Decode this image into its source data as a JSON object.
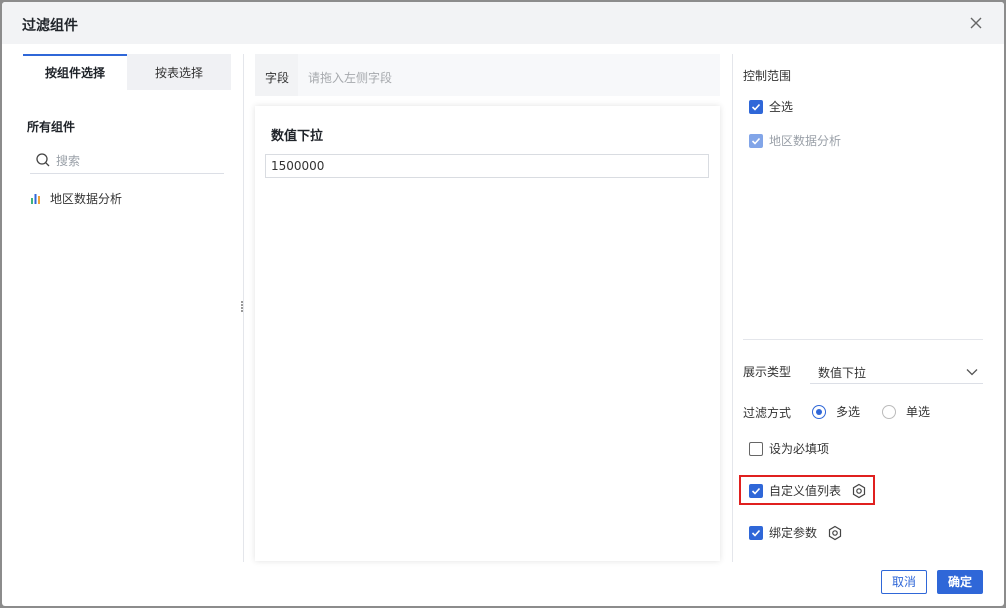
{
  "dialog": {
    "title": "过滤组件",
    "close_icon": "close-icon"
  },
  "left": {
    "tabs": [
      {
        "label": "按组件选择",
        "active": true
      },
      {
        "label": "按表选择",
        "active": false
      }
    ],
    "section_label": "所有组件",
    "search_placeholder": "搜索",
    "components": [
      {
        "label": "地区数据分析",
        "icon": "bar-chart-icon"
      }
    ]
  },
  "center": {
    "field_label": "字段",
    "field_placeholder": "请拖入左侧字段",
    "preview_title": "数值下拉",
    "preview_value": "1500000"
  },
  "right": {
    "scope_label": "控制范围",
    "select_all": "全选",
    "scope_items": [
      "地区数据分析"
    ],
    "display_type_label": "展示类型",
    "display_type_value": "数值下拉",
    "filter_mode_label": "过滤方式",
    "filter_modes": [
      {
        "label": "多选",
        "selected": true
      },
      {
        "label": "单选",
        "selected": false
      }
    ],
    "required_label": "设为必填项",
    "custom_list_label": "自定义值列表",
    "bind_param_label": "绑定参数"
  },
  "footer": {
    "cancel_label": "取消",
    "ok_label": "确定"
  },
  "colors": {
    "accent": "#2f67d8",
    "highlight": "#e0201f",
    "header_bg": "#f2f3f5"
  }
}
